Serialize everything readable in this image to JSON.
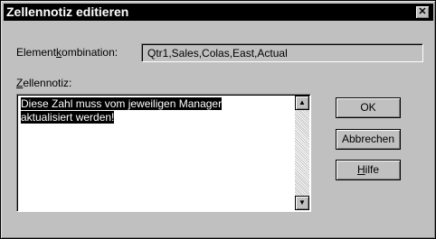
{
  "window": {
    "title": "Zellennotiz editieren",
    "close_glyph": "✕"
  },
  "combination": {
    "label_pre": "Element",
    "label_mnemonic": "k",
    "label_post": "ombination:",
    "value": "Qtr1,Sales,Colas,East,Actual"
  },
  "note": {
    "label_mnemonic": "Z",
    "label_post": "ellennotiz:",
    "line1": "Diese Zahl muss vom jeweiligen Manager",
    "line2": "aktualisiert werden!"
  },
  "scrollbar": {
    "up_glyph": "▲",
    "down_glyph": "▼"
  },
  "buttons": {
    "ok": "OK",
    "cancel": "Abbrechen",
    "help_mnemonic": "H",
    "help_post": "ilfe"
  }
}
